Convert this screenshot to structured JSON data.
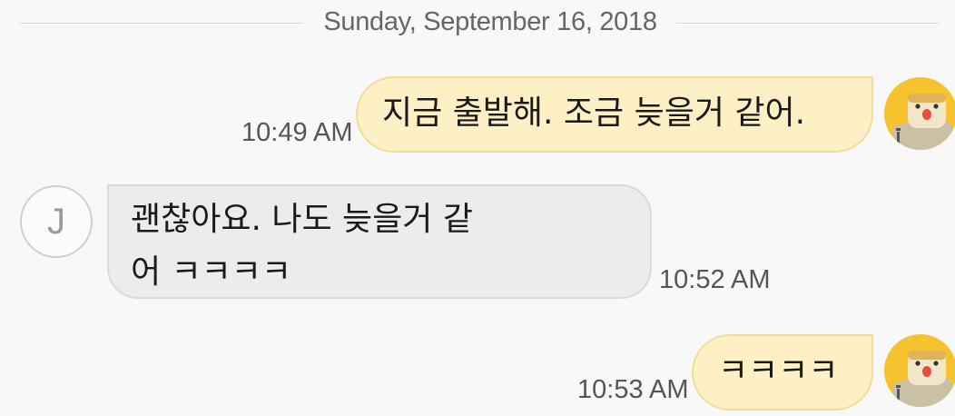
{
  "date_separator": "Sunday, September 16, 2018",
  "contact": {
    "initial": "J"
  },
  "messages": [
    {
      "direction": "out",
      "text": "지금 출발해. 조금 늦을거 같어.",
      "time": "10:49 AM"
    },
    {
      "direction": "in",
      "line1": "괜찮아요. 나도 늦을거 같",
      "line2": "어 ㅋㅋㅋㅋ",
      "time": "10:52 AM"
    },
    {
      "direction": "out",
      "text": "ㅋㅋㅋㅋ",
      "time": "10:53 AM"
    }
  ],
  "colors": {
    "background": "#f8f8f8",
    "outgoing_bubble": "#fdf0c4",
    "incoming_bubble": "#ececec",
    "avatar_yellow": "#f6c22e"
  },
  "icons": {
    "my_avatar": "toast-character-icon"
  }
}
